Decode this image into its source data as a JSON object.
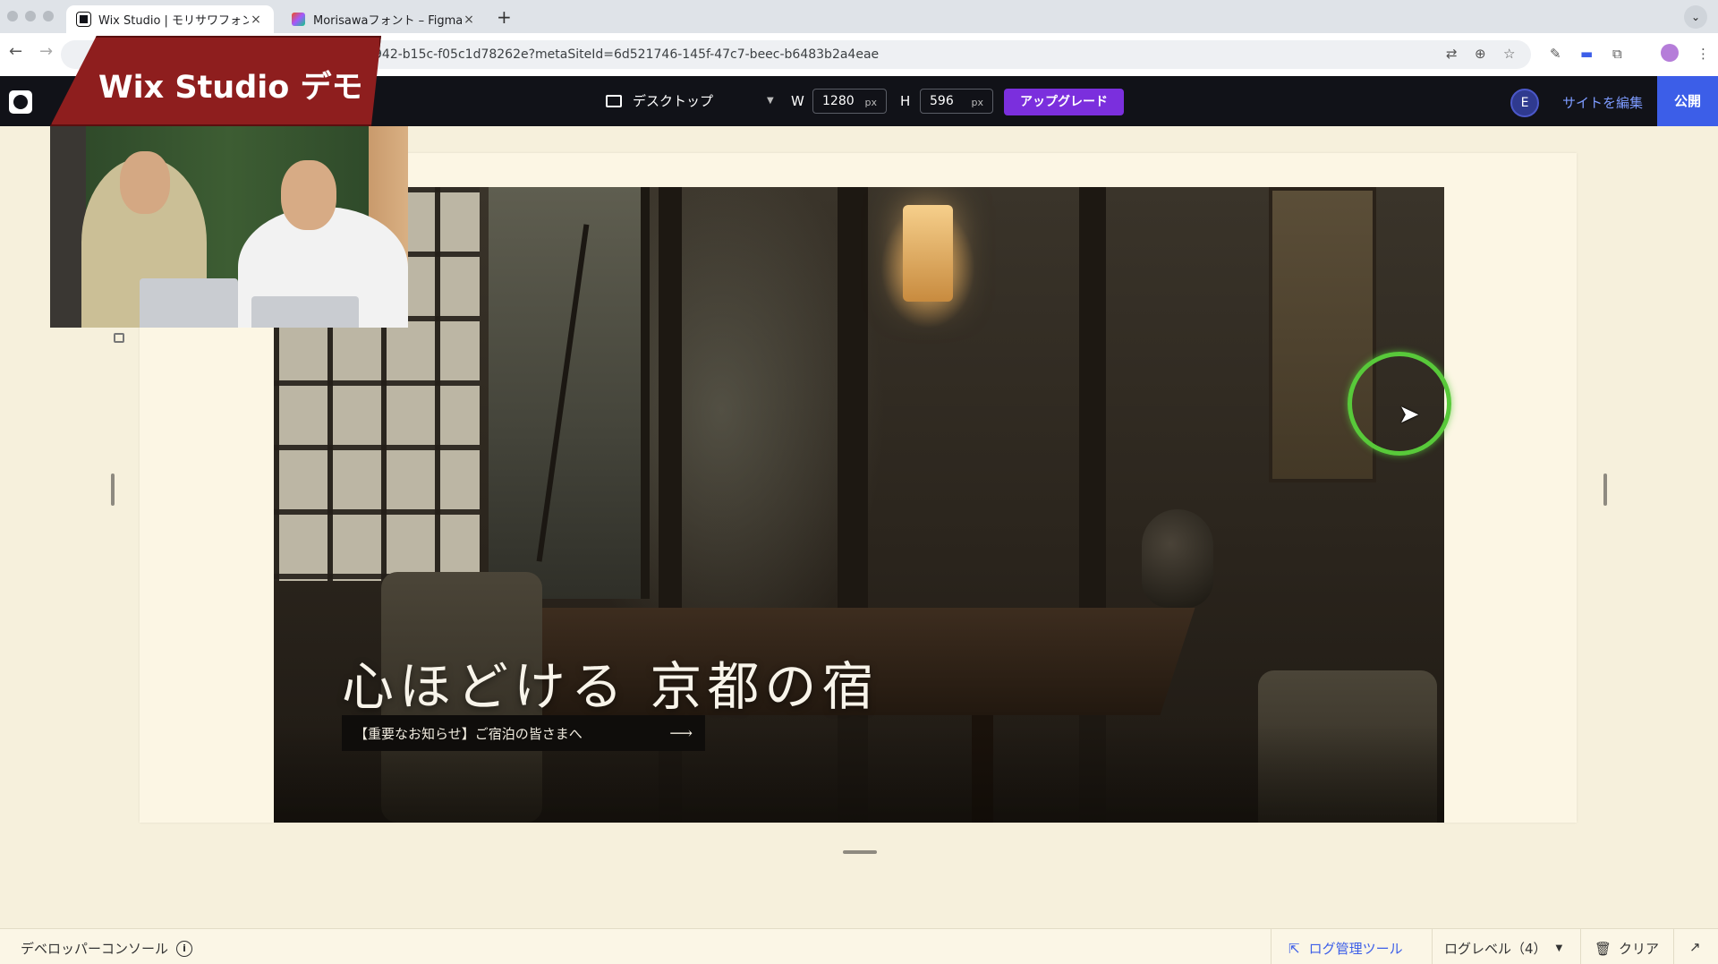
{
  "browser": {
    "tabs": [
      {
        "title": "Wix Studio | モリサワフォント",
        "close": "×",
        "active": true,
        "favicon_color": "#111218"
      },
      {
        "title": "Morisawaフォント – Figma",
        "close": "×",
        "active": false,
        "favicon_color": "#f24e1e"
      }
    ],
    "new_tab": "+",
    "tab_menu": "⌄",
    "url": "942-b15c-f05c1d78262e?metaSiteId=6d521746-145f-47c7-beec-b6483b2a4eae",
    "icons": [
      "back-icon",
      "forward-icon",
      "translate-icon",
      "zoom-icon",
      "bookmark-star-icon",
      "pen-icon",
      "extension-icon",
      "puzzle-icon",
      "profile-icon",
      "more-icon"
    ]
  },
  "overlay": {
    "banner": "Wix Studio デモ"
  },
  "editor": {
    "device": "デスクトップ",
    "width_label": "W",
    "width_value": "1280",
    "height_label": "H",
    "height_value": "596",
    "unit": "px",
    "upgrade": "アップグレード",
    "user_initial": "E",
    "edit_site": "サイトを編集",
    "publish": "公開",
    "accent_color": "#7b2fdd",
    "publish_color": "#3c5ee8"
  },
  "hero": {
    "title": "心ほどける 京都の宿",
    "notice": "【重要なお知らせ】ご宿泊の皆さまへ",
    "notice_arrow": "⟶"
  },
  "console": {
    "title": "デベロッパーコンソール",
    "info": "i",
    "log_tool": "ログ管理ツール",
    "log_level": "ログレベル（4）",
    "clear": "クリア"
  }
}
